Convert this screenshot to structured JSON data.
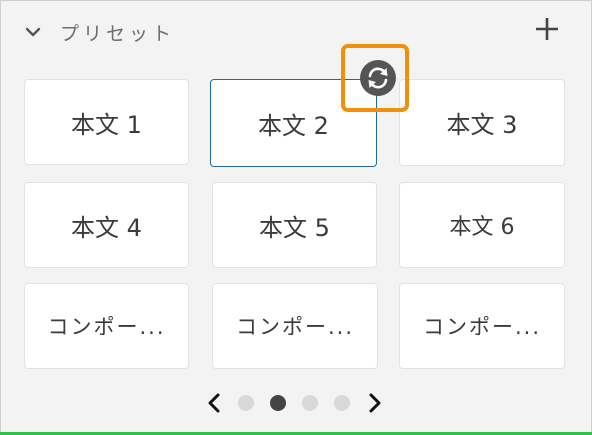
{
  "panel": {
    "title": "プリセット",
    "icons": {
      "collapse": "chevron-down-icon",
      "add": "plus-icon",
      "refresh": "refresh-icon"
    }
  },
  "presets": [
    {
      "label": "本文 1"
    },
    {
      "label": "本文 2",
      "selected": true
    },
    {
      "label": "本文 3"
    },
    {
      "label": "本文 4"
    },
    {
      "label": "本文 5"
    },
    {
      "label": "本文 6"
    },
    {
      "label": "コンポー..."
    },
    {
      "label": "コンポー..."
    },
    {
      "label": "コンポー..."
    }
  ],
  "pagination": {
    "pages": 4,
    "current": 2
  },
  "colors": {
    "highlight": "#f0900c",
    "selected_border": "#1e6aa6",
    "active_dot": "#444444"
  }
}
